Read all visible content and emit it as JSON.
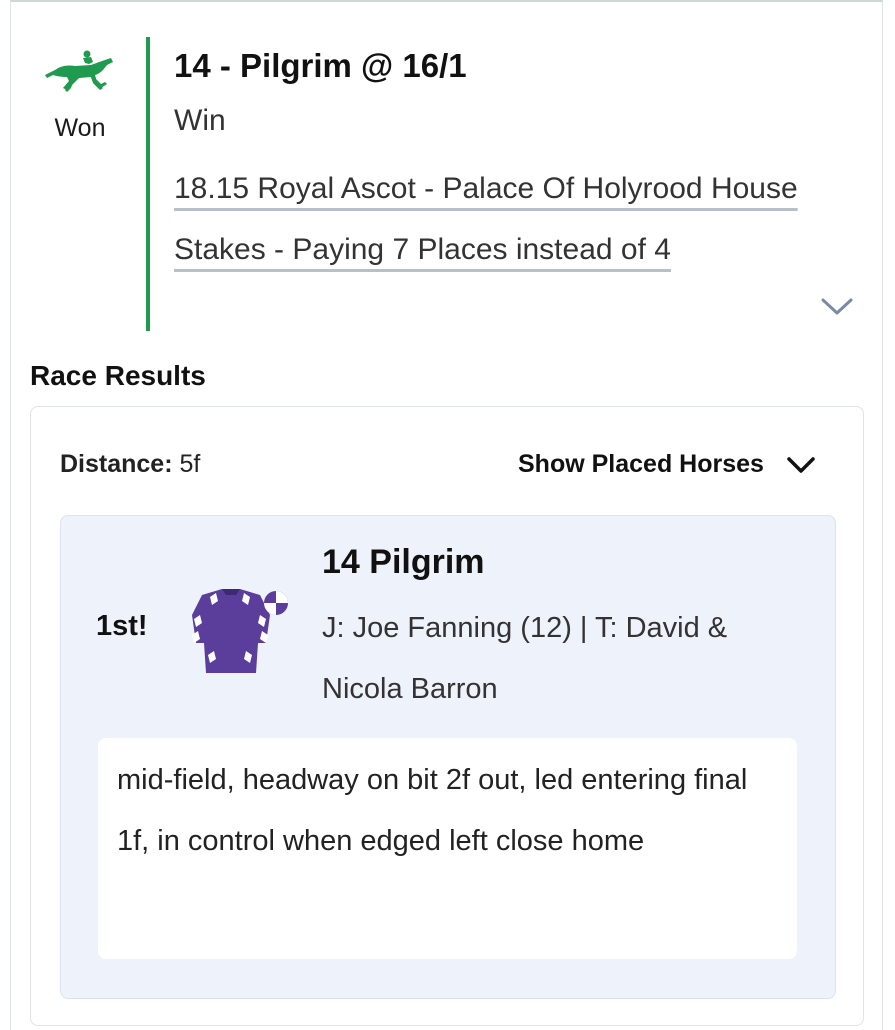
{
  "bet": {
    "status": "Won",
    "status_icon": "racing-horse-icon",
    "accent_color": "#1f9a4e",
    "selection": "14 - Pilgrim @ 16/1",
    "bet_type": "Win",
    "race_description": "18.15 Royal Ascot - Palace Of Holyrood House Stakes - Paying 7 Places instead of 4",
    "expand_icon": "chevron-down-icon"
  },
  "results": {
    "heading": "Race Results",
    "distance_label": "Distance:",
    "distance_value": "5f",
    "show_placed_label": "Show Placed Horses",
    "winner": {
      "position": "1st!",
      "silks_icon": "jockey-silks-icon",
      "name": "14 Pilgrim",
      "connections": "J: Joe Fanning (12) | T: David & Nicola Barron",
      "comment": "mid-field, headway on bit 2f out, led entering final 1f, in control when edged left close home"
    }
  }
}
